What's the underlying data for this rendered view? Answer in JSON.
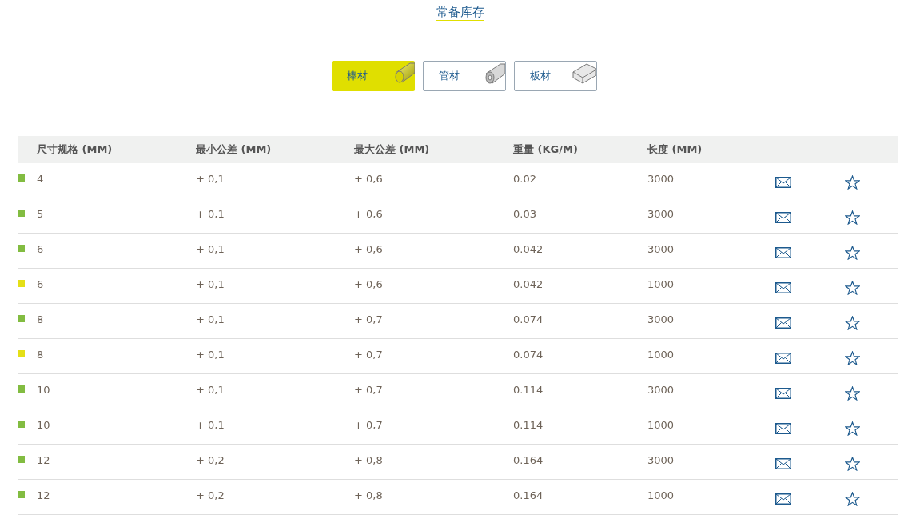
{
  "title": "常备库存",
  "tabs": [
    {
      "label": "棒材",
      "kind": "rod",
      "selected": true
    },
    {
      "label": "管材",
      "kind": "tube",
      "selected": false
    },
    {
      "label": "板材",
      "kind": "plate",
      "selected": false
    }
  ],
  "table": {
    "columns": [
      "尺寸规格 (MM)",
      "最小公差 (MM)",
      "最大公差 (MM)",
      "重量 (KG/M)",
      "长度 (MM)"
    ],
    "rows": [
      {
        "color": "#82bc41",
        "cells": [
          "4",
          "+ 0,1",
          "+ 0,6",
          "0.02",
          "3000"
        ]
      },
      {
        "color": "#82bc41",
        "cells": [
          "5",
          "+ 0,1",
          "+ 0,6",
          "0.03",
          "3000"
        ]
      },
      {
        "color": "#82bc41",
        "cells": [
          "6",
          "+ 0,1",
          "+ 0,6",
          "0.042",
          "3000"
        ]
      },
      {
        "color": "#e4df17",
        "cells": [
          "6",
          "+ 0,1",
          "+ 0,6",
          "0.042",
          "1000"
        ]
      },
      {
        "color": "#82bc41",
        "cells": [
          "8",
          "+ 0,1",
          "+ 0,7",
          "0.074",
          "3000"
        ]
      },
      {
        "color": "#e4df17",
        "cells": [
          "8",
          "+ 0,1",
          "+ 0,7",
          "0.074",
          "1000"
        ]
      },
      {
        "color": "#82bc41",
        "cells": [
          "10",
          "+ 0,1",
          "+ 0,7",
          "0.114",
          "3000"
        ]
      },
      {
        "color": "#82bc41",
        "cells": [
          "10",
          "+ 0,1",
          "+ 0,7",
          "0.114",
          "1000"
        ]
      },
      {
        "color": "#82bc41",
        "cells": [
          "12",
          "+ 0,2",
          "+ 0,8",
          "0.164",
          "3000"
        ]
      },
      {
        "color": "#82bc41",
        "cells": [
          "12",
          "+ 0,2",
          "+ 0,8",
          "0.164",
          "1000"
        ]
      }
    ]
  }
}
